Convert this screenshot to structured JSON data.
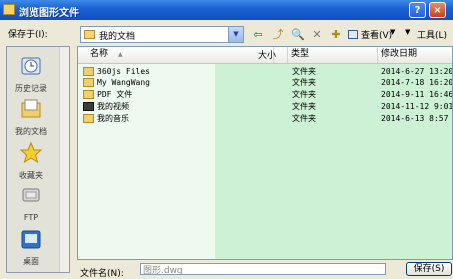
{
  "window": {
    "title": "浏览图形文件",
    "help_label": "?",
    "close_label": "×"
  },
  "lookin": {
    "label": "保存于(I):",
    "value": "我的文档",
    "dropdown": "▼"
  },
  "toolbar": {
    "back": "⇦",
    "up": "⤴",
    "search": "🔍",
    "delete": "✕",
    "newfolder": "✚",
    "view_label": "查看(V)",
    "view_arrow": "▼",
    "tools_arrow": "▼",
    "tools_label": "工具(L)"
  },
  "places": [
    {
      "label": "历史记录",
      "icon": "history-icon"
    },
    {
      "label": "我的文档",
      "icon": "documents-icon"
    },
    {
      "label": "收藏夹",
      "icon": "favorites-star-icon"
    },
    {
      "label": "FTP",
      "icon": "ftp-icon"
    },
    {
      "label": "桌面",
      "icon": "desktop-icon"
    }
  ],
  "columns": {
    "name": "名称",
    "size": "大小",
    "type": "类型",
    "date": "修改日期",
    "sort_arrow": "▲"
  },
  "files": [
    {
      "name": "360js Files",
      "type": "文件夹",
      "date": "2014-6-27 13:20",
      "icon": "folder-icon"
    },
    {
      "name": "My WangWang",
      "type": "文件夹",
      "date": "2014-7-18 16:20",
      "icon": "folder-icon"
    },
    {
      "name": "PDF 文件",
      "type": "文件夹",
      "date": "2014-9-11 16:46",
      "icon": "folder-icon"
    },
    {
      "name": "我的视频",
      "type": "文件夹",
      "date": "2014-11-12 9:01",
      "icon": "video-folder-icon"
    },
    {
      "name": "我的音乐",
      "type": "文件夹",
      "date": "2014-6-13 8:57",
      "icon": "music-folder-icon"
    }
  ],
  "filename": {
    "label": "文件名(N):",
    "value": "图形.dwg"
  },
  "save_button": {
    "label": "保存(S)"
  },
  "colors": {
    "titlebar": "#1a5fd0",
    "list_highlight": "#cdf1d4"
  }
}
